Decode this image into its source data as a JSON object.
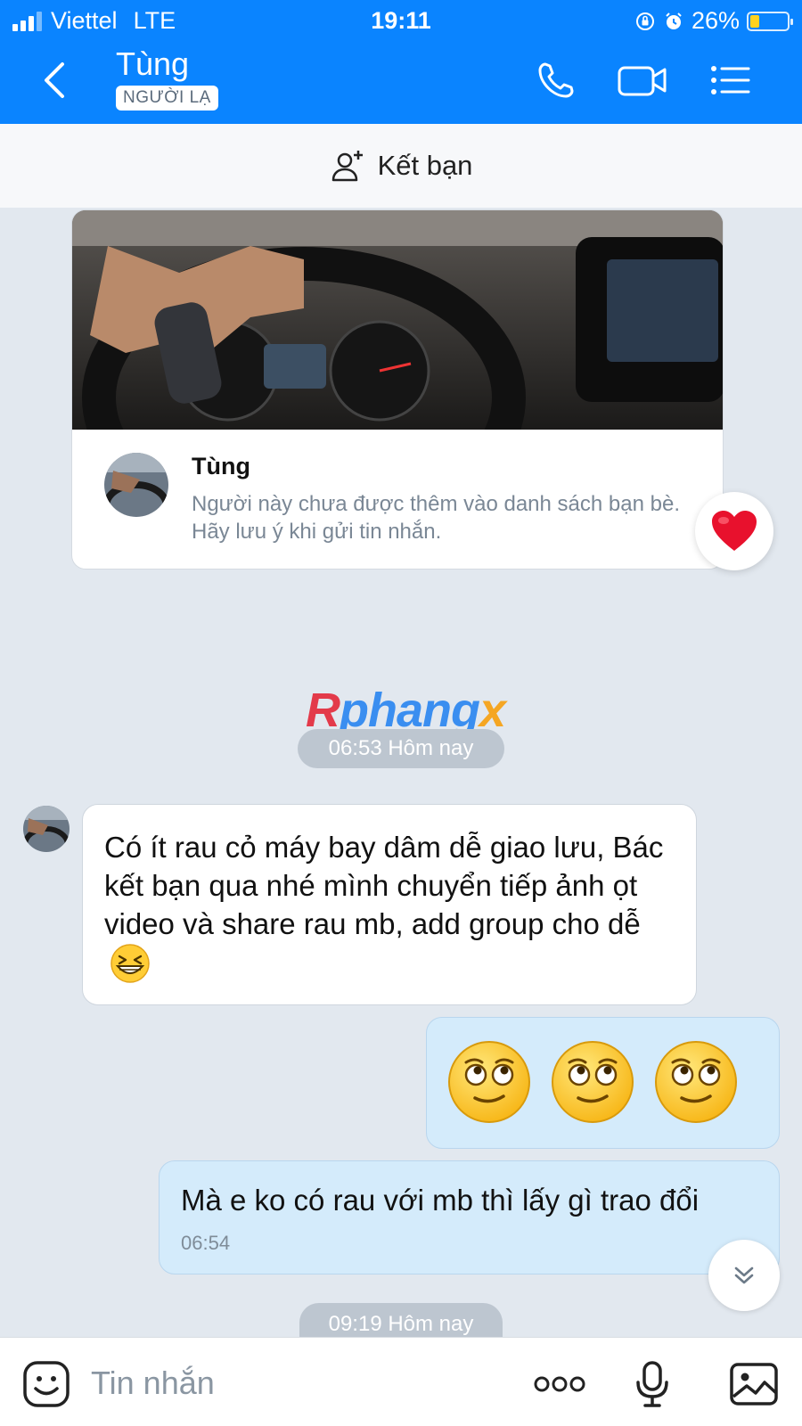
{
  "status_bar": {
    "carrier": "Viettel",
    "network": "LTE",
    "time": "19:11",
    "battery": "26%",
    "battery_level": 0.26
  },
  "header": {
    "title": "Tùng",
    "badge": "NGƯỜI LẠ",
    "icons": [
      "back-icon",
      "phone-icon",
      "video-call-icon",
      "menu-icon"
    ]
  },
  "add_friend": {
    "label": "Kết bạn",
    "icon": "add-user-icon"
  },
  "profile_card": {
    "name": "Tùng",
    "description": "Người này chưa được thêm vào danh sách bạn bè. Hãy lưu ý khi gửi tin nhắn.",
    "reaction_icon": "heart-icon"
  },
  "watermark": {
    "part1": "R",
    "part2": "phang",
    "part3": "x"
  },
  "messages": {
    "separator_1": "06:53 Hôm nay",
    "incoming_1": "Có ít rau cỏ máy bay dâm dễ giao lưu, Bác kết bạn qua nhé mình chuyển tiếp ảnh ọt video và share rau mb, add group cho dễ",
    "outgoing_emoji_count": 3,
    "outgoing_2": "Mà e ko có rau với mb thì lấy gì trao đổi",
    "outgoing_2_time": "06:54",
    "separator_2": "09:19 Hôm nay"
  },
  "input_bar": {
    "placeholder": "Tin nhắn",
    "icons": [
      "sticker-icon",
      "more-icon",
      "microphone-icon",
      "image-icon"
    ]
  },
  "colors": {
    "header_blue": "#0a84ff",
    "outgoing_bubble": "#d4ebfb",
    "chat_background": "#e2e8ef"
  }
}
